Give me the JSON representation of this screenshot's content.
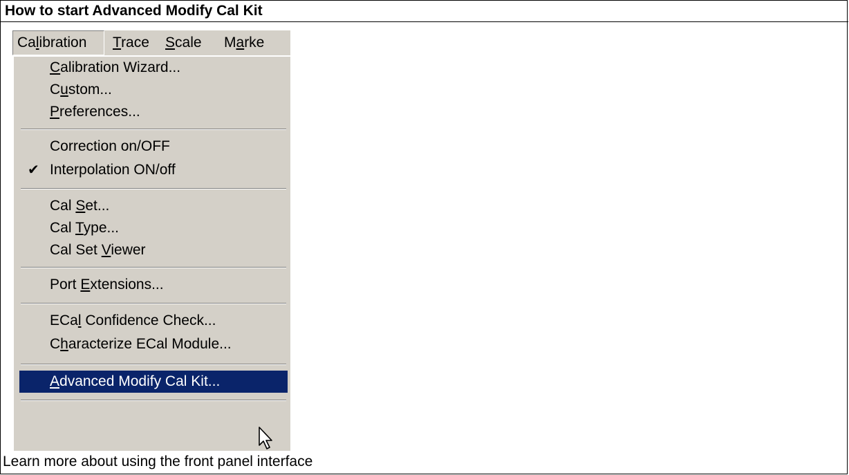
{
  "heading": "How to start Advanced Modify Cal Kit",
  "menubar": {
    "items": [
      {
        "label": "Calibration",
        "accel_index": 2
      },
      {
        "label": "Trace",
        "accel_index": 0
      },
      {
        "label": "Scale",
        "accel_index": 0
      },
      {
        "label": "Marke",
        "accel_index": 1
      }
    ]
  },
  "menu": {
    "items": [
      {
        "label": "Calibration Wizard...",
        "accel_index": 0
      },
      {
        "label": "Custom...",
        "accel_index": 1
      },
      {
        "label": "Preferences...",
        "accel_index": 0
      },
      {
        "label": "Correction on/OFF",
        "accel_index": -1
      },
      {
        "label": "Interpolation ON/off",
        "accel_index": -1,
        "checked": true
      },
      {
        "label": "Cal Set...",
        "accel_index": 4
      },
      {
        "label": "Cal Type...",
        "accel_index": 4
      },
      {
        "label": "Cal Set Viewer",
        "accel_index": 8
      },
      {
        "label": "Port Extensions...",
        "accel_index": 5
      },
      {
        "label": "ECal Confidence Check...",
        "accel_index": 3
      },
      {
        "label": "Characterize ECal Module...",
        "accel_index": 1
      },
      {
        "label": "Advanced Modify Cal Kit...",
        "accel_index": 0,
        "highlighted": true
      }
    ]
  },
  "footer": "Learn more about using the front panel interface",
  "colors": {
    "menu_face": "#d4d0c8",
    "highlight": "#0a246a",
    "highlight_text": "#ffffff"
  }
}
